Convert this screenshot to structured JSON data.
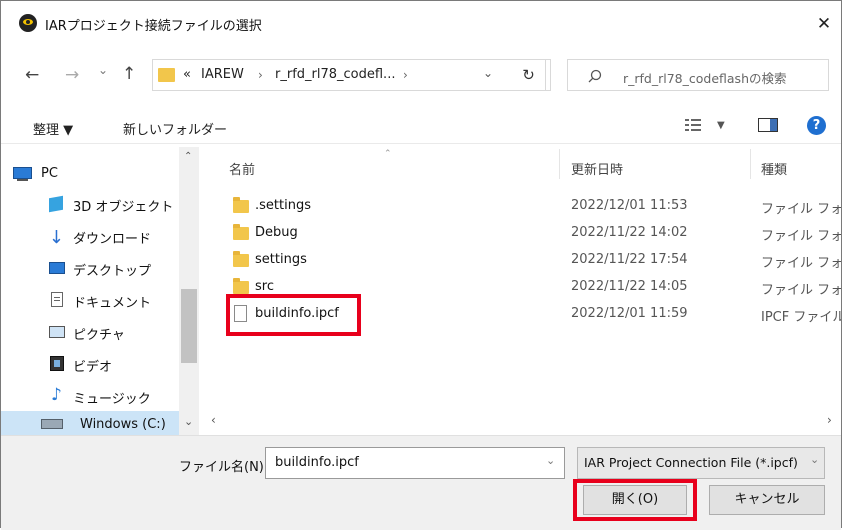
{
  "window": {
    "title": "IARプロジェクト接続ファイルの選択",
    "close_glyph": "✕"
  },
  "nav": {
    "back": "←",
    "forward": "→",
    "recent": "⌄",
    "up": "↑",
    "refresh": "↻",
    "dropdown": "⌄"
  },
  "address": {
    "overflow": "«",
    "crumbs": [
      "IAREW",
      "r_rfd_rl78_codefl..."
    ],
    "sep": "›"
  },
  "search": {
    "placeholder": "r_rfd_rl78_codeflashの検索",
    "icon": "search-icon"
  },
  "toolbar": {
    "organize": "整理 ▼",
    "new_folder": "新しいフォルダー",
    "view_dropdown": "▼",
    "help": "?"
  },
  "sidebar": {
    "items": [
      {
        "label": "PC",
        "icon": "pc-icon"
      },
      {
        "label": "3D オブジェクト",
        "icon": "3d-objects-icon"
      },
      {
        "label": "ダウンロード",
        "icon": "download-icon"
      },
      {
        "label": "デスクトップ",
        "icon": "desktop-icon"
      },
      {
        "label": "ドキュメント",
        "icon": "document-icon"
      },
      {
        "label": "ピクチャ",
        "icon": "pictures-icon"
      },
      {
        "label": "ビデオ",
        "icon": "video-icon"
      },
      {
        "label": "ミュージック",
        "icon": "music-icon"
      },
      {
        "label": "Windows (C:)",
        "icon": "drive-icon"
      }
    ]
  },
  "columns": {
    "name": "名前",
    "date": "更新日時",
    "type": "種類"
  },
  "files": [
    {
      "name": ".settings",
      "date": "2022/12/01 11:53",
      "type": "ファイル フォルダー",
      "kind": "folder"
    },
    {
      "name": "Debug",
      "date": "2022/11/22 14:02",
      "type": "ファイル フォルダー",
      "kind": "folder"
    },
    {
      "name": "settings",
      "date": "2022/11/22 17:54",
      "type": "ファイル フォルダー",
      "kind": "folder"
    },
    {
      "name": "src",
      "date": "2022/11/22 14:05",
      "type": "ファイル フォルダー",
      "kind": "folder"
    },
    {
      "name": "buildinfo.ipcf",
      "date": "2022/12/01 11:59",
      "type": "IPCF ファイル",
      "kind": "file"
    }
  ],
  "footer": {
    "filename_label": "ファイル名(N):",
    "filename_value": "buildinfo.ipcf",
    "filter": "IAR Project Connection File (*.ipcf)",
    "open": "開く(O)",
    "cancel": "キャンセル"
  },
  "colors": {
    "highlight": "#e8001c",
    "folder": "#f2c64b",
    "help_blue": "#1f6fd0"
  }
}
